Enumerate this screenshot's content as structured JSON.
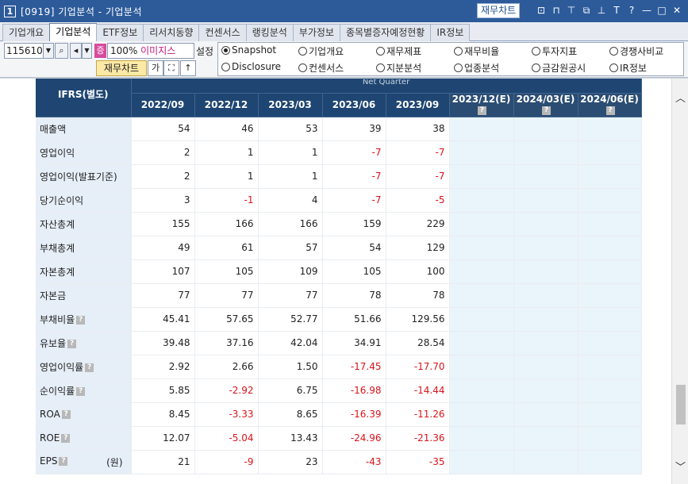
{
  "window": {
    "number": "1",
    "title": "[0919] 기업분석 - 기업분석",
    "finchart_button": "재무차트",
    "icons": [
      "chart-icon",
      "pin-up-icon",
      "pin-icon",
      "restore-icon",
      "stick-icon",
      "text-icon",
      "help-icon",
      "minimize-icon",
      "maximize-icon",
      "close-icon"
    ]
  },
  "tabs": [
    "기업개요",
    "기업분석",
    "ETF정보",
    "리서치동향",
    "컨센서스",
    "랭킹분석",
    "부가정보",
    "종목별증자예정현황",
    "IR정보"
  ],
  "active_tab": 1,
  "toolbar": {
    "code": "115610",
    "jeung_badge": "증",
    "company_pct": "100%",
    "company_name": "이미지스",
    "setting_label": "설정",
    "finchart_button": "재무차트",
    "font_button": "가"
  },
  "radios": [
    {
      "label": "Snapshot",
      "checked": true
    },
    {
      "label": "기업개요",
      "checked": false
    },
    {
      "label": "재무제표",
      "checked": false
    },
    {
      "label": "재무비율",
      "checked": false
    },
    {
      "label": "투자지표",
      "checked": false
    },
    {
      "label": "경쟁사비교",
      "checked": false
    },
    {
      "label": "Disclosure",
      "checked": false
    },
    {
      "label": "컨센서스",
      "checked": false
    },
    {
      "label": "지분분석",
      "checked": false
    },
    {
      "label": "업종분석",
      "checked": false
    },
    {
      "label": "금감원공시",
      "checked": false
    },
    {
      "label": "IR정보",
      "checked": false
    }
  ],
  "table": {
    "corner_label": "IFRS(별도)",
    "group_label": "Net Quarter",
    "columns": [
      {
        "label": "2022/09",
        "estimate": false
      },
      {
        "label": "2022/12",
        "estimate": false
      },
      {
        "label": "2023/03",
        "estimate": false
      },
      {
        "label": "2023/06",
        "estimate": false
      },
      {
        "label": "2023/09",
        "estimate": false
      },
      {
        "label": "2023/12(E)",
        "estimate": true
      },
      {
        "label": "2024/03(E)",
        "estimate": true
      },
      {
        "label": "2024/06(E)",
        "estimate": true
      }
    ],
    "rows": [
      {
        "label": "매출액",
        "help": false,
        "unit": "",
        "values": [
          "54",
          "46",
          "53",
          "39",
          "38",
          "",
          "",
          ""
        ]
      },
      {
        "label": "영업이익",
        "help": false,
        "unit": "",
        "values": [
          "2",
          "1",
          "1",
          "-7",
          "-7",
          "",
          "",
          ""
        ]
      },
      {
        "label": "영업이익(발표기준)",
        "help": false,
        "unit": "",
        "values": [
          "2",
          "1",
          "1",
          "-7",
          "-7",
          "",
          "",
          ""
        ]
      },
      {
        "label": "당기순이익",
        "help": false,
        "unit": "",
        "values": [
          "3",
          "-1",
          "4",
          "-7",
          "-5",
          "",
          "",
          ""
        ]
      },
      {
        "label": "자산총계",
        "help": false,
        "unit": "",
        "values": [
          "155",
          "166",
          "166",
          "159",
          "229",
          "",
          "",
          ""
        ]
      },
      {
        "label": "부채총계",
        "help": false,
        "unit": "",
        "values": [
          "49",
          "61",
          "57",
          "54",
          "129",
          "",
          "",
          ""
        ]
      },
      {
        "label": "자본총계",
        "help": false,
        "unit": "",
        "values": [
          "107",
          "105",
          "109",
          "105",
          "100",
          "",
          "",
          ""
        ]
      },
      {
        "label": "자본금",
        "help": false,
        "unit": "",
        "values": [
          "77",
          "77",
          "77",
          "78",
          "78",
          "",
          "",
          ""
        ]
      },
      {
        "label": "부채비율",
        "help": true,
        "unit": "",
        "values": [
          "45.41",
          "57.65",
          "52.77",
          "51.66",
          "129.56",
          "",
          "",
          ""
        ]
      },
      {
        "label": "유보율",
        "help": true,
        "unit": "",
        "values": [
          "39.48",
          "37.16",
          "42.04",
          "34.91",
          "28.54",
          "",
          "",
          ""
        ]
      },
      {
        "label": "영업이익률",
        "help": true,
        "unit": "",
        "values": [
          "2.92",
          "2.66",
          "1.50",
          "-17.45",
          "-17.70",
          "",
          "",
          ""
        ]
      },
      {
        "label": "순이익률",
        "help": true,
        "unit": "",
        "values": [
          "5.85",
          "-2.92",
          "6.75",
          "-16.98",
          "-14.44",
          "",
          "",
          ""
        ]
      },
      {
        "label": "ROA",
        "help": true,
        "unit": "",
        "values": [
          "8.45",
          "-3.33",
          "8.65",
          "-16.39",
          "-11.26",
          "",
          "",
          ""
        ]
      },
      {
        "label": "ROE",
        "help": true,
        "unit": "",
        "values": [
          "12.07",
          "-5.04",
          "13.43",
          "-24.96",
          "-21.36",
          "",
          "",
          ""
        ]
      },
      {
        "label": "EPS",
        "help": true,
        "unit": "(원)",
        "values": [
          "21",
          "-9",
          "23",
          "-43",
          "-35",
          "",
          "",
          ""
        ]
      }
    ]
  },
  "colors": {
    "title_bar": "#2d5b9a",
    "table_header": "#1f4672",
    "row_label_bg": "#e6eef7",
    "estimate_bg": "#eaf4fb",
    "negative": "#d8141c"
  }
}
